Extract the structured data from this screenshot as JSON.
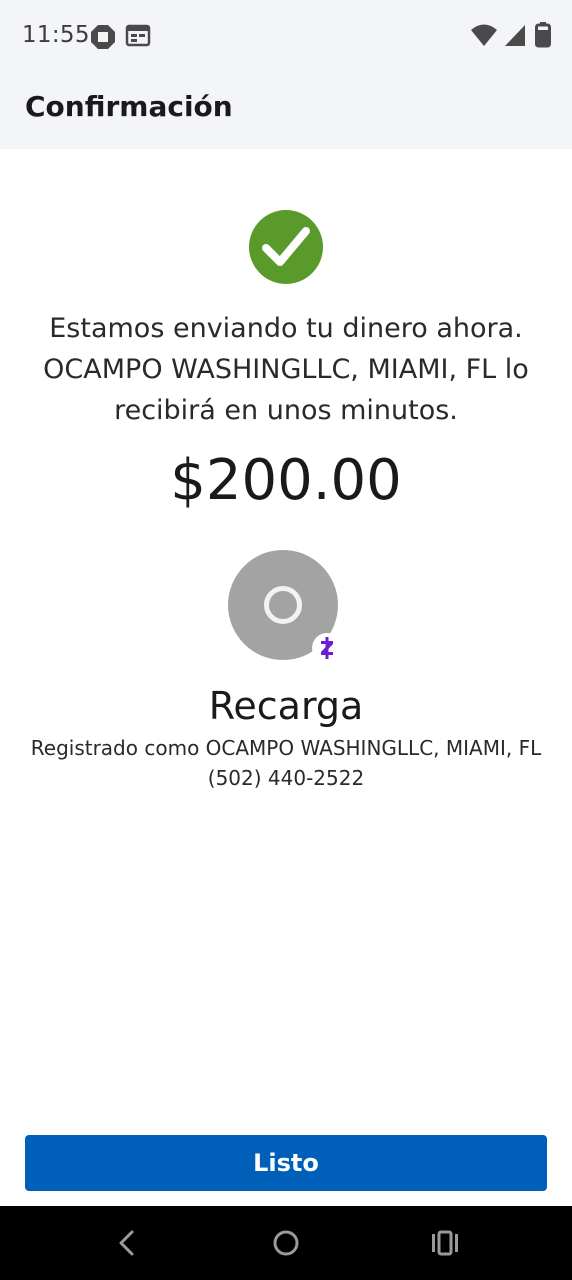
{
  "status_bar": {
    "time": "11:55",
    "icons": [
      "chase-app-icon",
      "calendar-icon",
      "wifi-icon",
      "cell-signal-icon",
      "battery-icon"
    ]
  },
  "app_bar": {
    "title": "Confirmación"
  },
  "confirmation": {
    "status_icon": "check-circle-icon",
    "status_color": "#5a9a2a",
    "message": "Estamos enviando tu dinero ahora. OCAMPO WASHINGLLC, MIAMI, FL lo recibirá en unos minutos.",
    "amount": "$200.00"
  },
  "recipient": {
    "avatar_icon": "placeholder-avatar-icon",
    "badge_icon": "zelle-icon",
    "badge_color": "#6d1ed4",
    "name": "Recarga",
    "registered_as": "Registrado como OCAMPO WASHINGLLC, MIAMI, FL",
    "phone": "(502) 440-2522"
  },
  "actions": {
    "done_label": "Listo",
    "accent_color": "#0060b9"
  },
  "nav_bar": {
    "icons": [
      "back-icon",
      "home-icon",
      "recents-icon"
    ]
  }
}
